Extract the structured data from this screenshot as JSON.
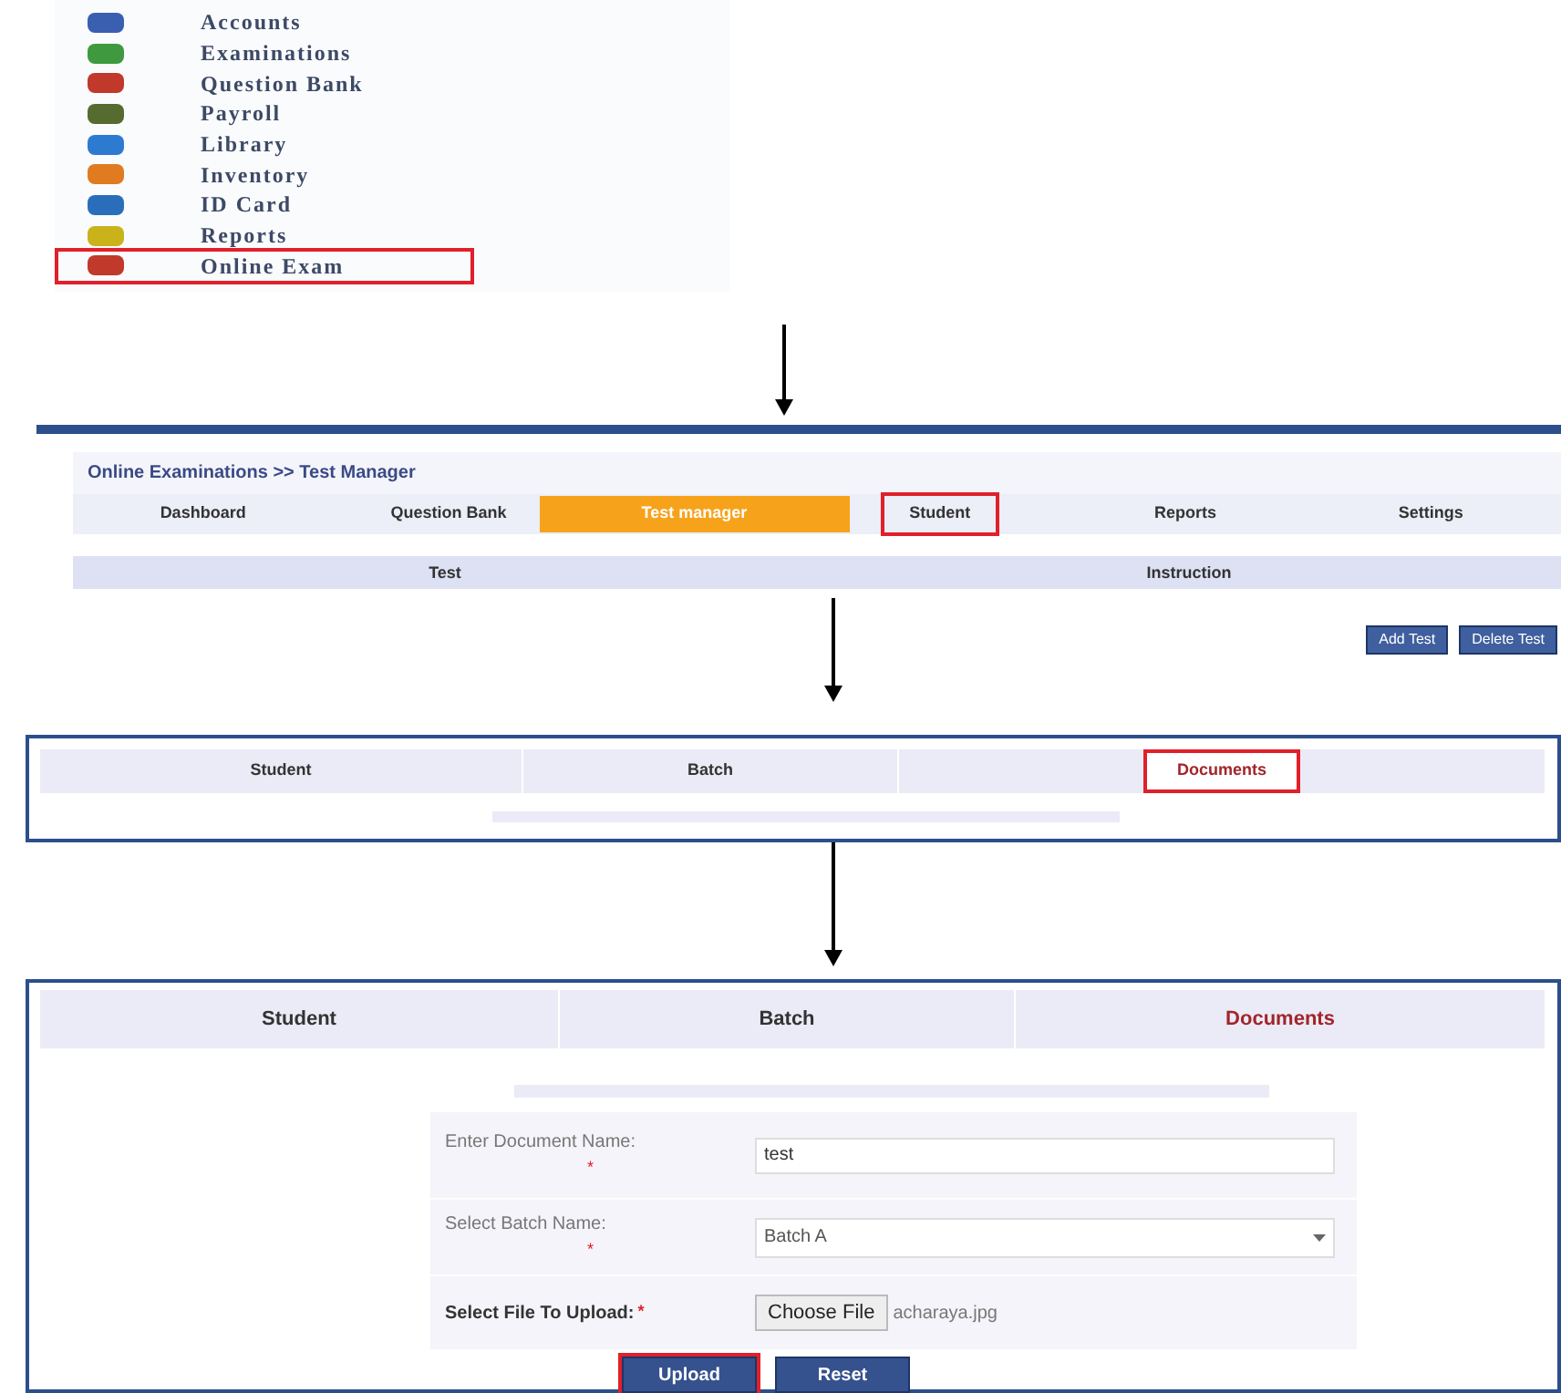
{
  "menu": {
    "items": [
      {
        "label": "Accounts",
        "highlighted": false
      },
      {
        "label": "Examinations",
        "highlighted": false
      },
      {
        "label": "Question Bank",
        "highlighted": false
      },
      {
        "label": "Payroll",
        "highlighted": false
      },
      {
        "label": "Library",
        "highlighted": false
      },
      {
        "label": "Inventory",
        "highlighted": false
      },
      {
        "label": "ID Card",
        "highlighted": false
      },
      {
        "label": "Reports",
        "highlighted": false
      },
      {
        "label": "Online Exam",
        "highlighted": true
      }
    ]
  },
  "test_manager": {
    "breadcrumb": "Online Examinations >> Test Manager",
    "tabs": [
      {
        "label": "Dashboard",
        "selected": false,
        "highlighted": false
      },
      {
        "label": "Question Bank",
        "selected": false,
        "highlighted": false
      },
      {
        "label": "Test manager",
        "selected": true,
        "highlighted": false
      },
      {
        "label": "Student",
        "selected": false,
        "highlighted": true
      },
      {
        "label": "Reports",
        "selected": false,
        "highlighted": false
      },
      {
        "label": "Settings",
        "selected": false,
        "highlighted": false
      }
    ],
    "columns": [
      "Test",
      "Instruction"
    ],
    "buttons": [
      "Add Test",
      "Delete Test"
    ]
  },
  "student_tabs": {
    "tabs": [
      {
        "label": "Student",
        "selected": false,
        "highlighted": false
      },
      {
        "label": "Batch",
        "selected": false,
        "highlighted": false
      },
      {
        "label": "Documents",
        "selected": true,
        "highlighted": true
      }
    ]
  },
  "documents": {
    "tabs": [
      {
        "label": "Student",
        "selected": false,
        "highlighted": false
      },
      {
        "label": "Batch",
        "selected": false,
        "highlighted": false
      },
      {
        "label": "Documents",
        "selected": true,
        "highlighted": false
      }
    ],
    "form": {
      "document_name": {
        "label": "Enter Document Name:",
        "required_mark": "*",
        "value": "test"
      },
      "batch": {
        "label": "Select Batch Name:",
        "required_mark": "*",
        "value": "Batch A"
      },
      "file": {
        "label": "Select File To Upload:",
        "required_mark": "*",
        "button": "Choose File",
        "file_name": "acharaya.jpg"
      }
    },
    "buttons": [
      {
        "label": "Upload",
        "highlighted": true
      },
      {
        "label": "Reset",
        "highlighted": false
      }
    ]
  }
}
